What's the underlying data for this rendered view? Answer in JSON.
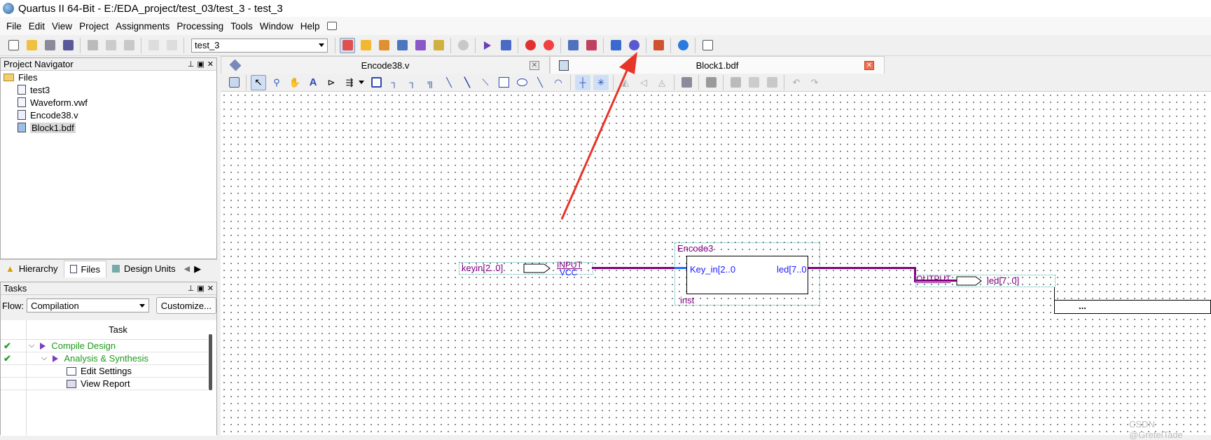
{
  "window": {
    "title": "Quartus II 64-Bit - E:/EDA_project/test_03/test_3 - test_3"
  },
  "menu": [
    "File",
    "Edit",
    "View",
    "Project",
    "Assignments",
    "Processing",
    "Tools",
    "Window",
    "Help"
  ],
  "toolbar": {
    "project_value": "test_3"
  },
  "navigator": {
    "title": "Project Navigator",
    "root": "Files",
    "files": [
      "test3",
      "Waveform.vwf",
      "Encode38.v",
      "Block1.bdf"
    ],
    "tabs": [
      "Hierarchy",
      "Files",
      "Design Units"
    ]
  },
  "tasks": {
    "title": "Tasks",
    "flow_label": "Flow:",
    "flow_value": "Compilation",
    "customize_label": "Customize...",
    "column_header": "Task",
    "rows": [
      "Compile Design",
      "Analysis & Synthesis",
      "Edit Settings",
      "View Report"
    ]
  },
  "editor": {
    "tabs": [
      "Encode38.v",
      "Block1.bdf"
    ],
    "active_tab": "Block1.bdf"
  },
  "schematic": {
    "input_pin_name": "keyin[2..0]",
    "input_type": "INPUT",
    "input_default": "VCC",
    "block_title": "Encode3",
    "block_port_in": "Key_in[2..0",
    "block_port_out": "led[7..0",
    "instance": "inst",
    "output_type": "OUTPUT",
    "output_pin_name": "led[7..0]",
    "ellipsis": "..."
  },
  "colors": {
    "wire": "#800080",
    "bus_in": "#1e6fff",
    "pin_text": "#800080",
    "block_text": "#1a1aff",
    "arrow": "#e8352a"
  },
  "watermark": "CSDN @GretelTade"
}
